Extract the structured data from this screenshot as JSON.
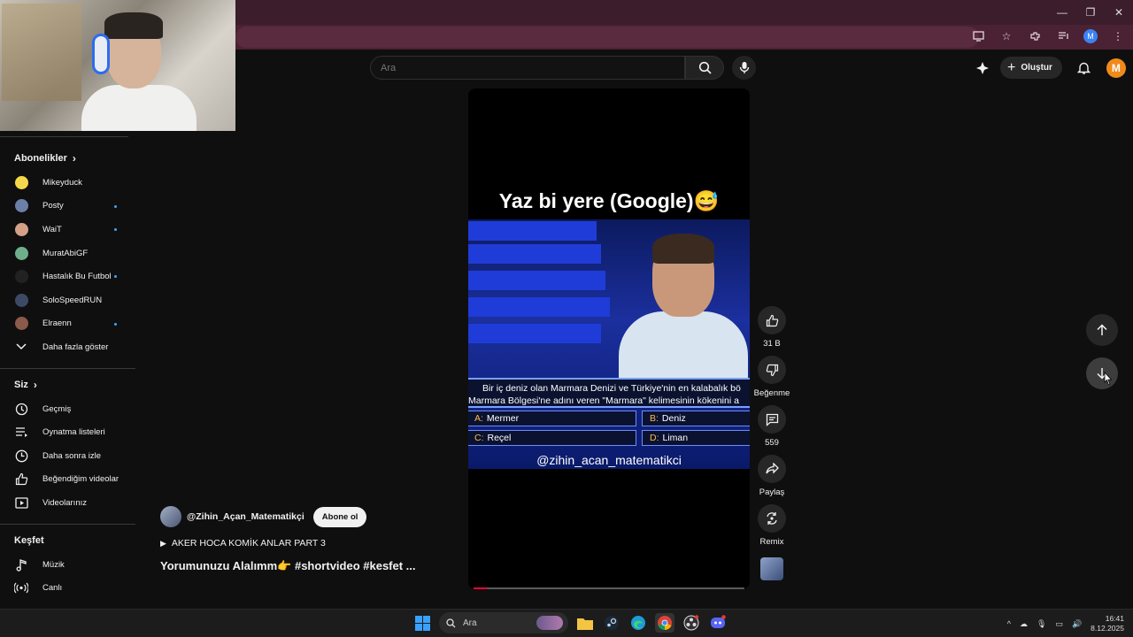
{
  "window": {
    "minimize": "—",
    "restore": "❐",
    "close": "✕"
  },
  "browser": {
    "profile_initial": "M"
  },
  "masthead": {
    "search_placeholder": "Ara",
    "create_label": "Oluştur",
    "avatar_initial": "M"
  },
  "sidebar": {
    "subscriptions_title": "Abonelikler",
    "channels": [
      {
        "name": "Mikeyduck",
        "live": false,
        "color": "#f5d84a"
      },
      {
        "name": "Posty",
        "live": true,
        "color": "#6b7fa8"
      },
      {
        "name": "WaiT",
        "live": true,
        "color": "#d4a088"
      },
      {
        "name": "MuratAbiGF",
        "live": false,
        "color": "#6fae8a"
      },
      {
        "name": "Hastalık Bu Futbol",
        "live": true,
        "color": "#222222"
      },
      {
        "name": "SoloSpeedRUN",
        "live": false,
        "color": "#3d4a66"
      },
      {
        "name": "Elraenn",
        "live": true,
        "color": "#8a5a4a"
      }
    ],
    "show_more": "Daha fazla göster",
    "you_title": "Siz",
    "you_items": [
      "Geçmiş",
      "Oynatma listeleri",
      "Daha sonra izle",
      "Beğendiğim videolar",
      "Videolarınız"
    ],
    "explore_title": "Keşfet",
    "explore_items": [
      "Müzik",
      "Canlı"
    ]
  },
  "video": {
    "overlay_title": "Yaz bi yere (Google)😅",
    "question_line1": "Bir iç deniz olan Marmara Denizi ve Türkiye'nin en kalabalık bö",
    "question_line2": "Marmara Bölgesi'ne adını veren \"Marmara\" kelimesinin kökenini a",
    "options": [
      {
        "key": "A:",
        "text": "Mermer"
      },
      {
        "key": "B:",
        "text": "Deniz"
      },
      {
        "key": "C:",
        "text": "Reçel"
      },
      {
        "key": "D:",
        "text": "Liman"
      }
    ],
    "handle": "@zihin_acan_matematikci",
    "progress": 0.05
  },
  "actions": {
    "likes": "31 B",
    "dislike_label": "Beğenme",
    "comments": "559",
    "share_label": "Paylaş",
    "remix_label": "Remix"
  },
  "meta": {
    "channel": "@Zihin_Açan_Matematikçi",
    "subscribe": "Abone ol",
    "playlist": "AKER HOCA KOMİK ANLAR PART 3",
    "title": "Yorumunuzu Alalımm👉 #shortvideo #kesfet ..."
  },
  "taskbar": {
    "search_label": "Ara",
    "time": "16:41",
    "date": "8.12.2025"
  }
}
